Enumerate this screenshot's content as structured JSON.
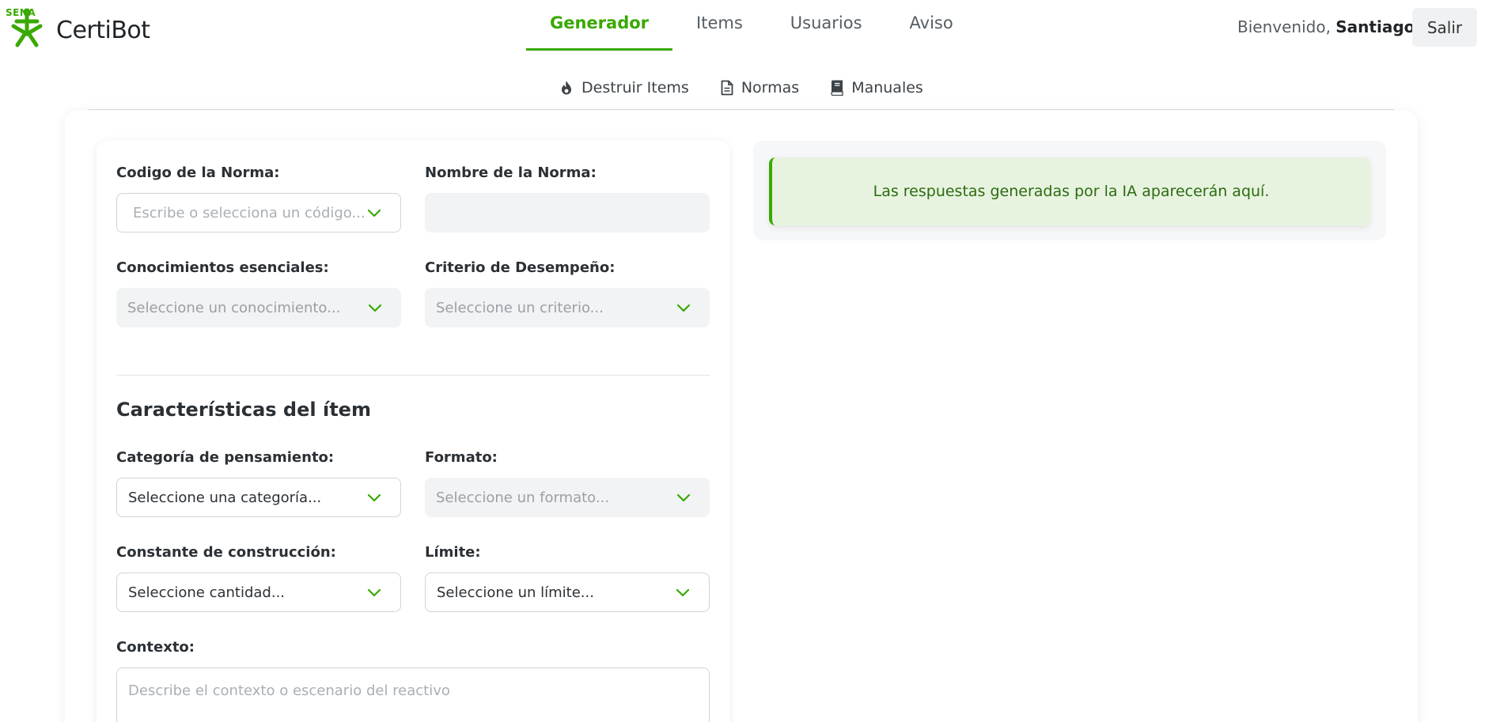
{
  "brand": {
    "mark": "SENA",
    "name": "CertiBot",
    "accent": "#39a900"
  },
  "nav": {
    "tabs": [
      {
        "label": "Generador",
        "active": true
      },
      {
        "label": "Items",
        "active": false
      },
      {
        "label": "Usuarios",
        "active": false
      },
      {
        "label": "Aviso",
        "active": false
      }
    ]
  },
  "user": {
    "greeting": "Bienvenido,",
    "name": "Santiago",
    "logout_label": "Salir"
  },
  "subnav": {
    "items": [
      {
        "label": "Destruir Items",
        "icon": "fire-icon"
      },
      {
        "label": "Normas",
        "icon": "document-icon"
      },
      {
        "label": "Manuales",
        "icon": "book-icon"
      }
    ]
  },
  "form": {
    "norma_code": {
      "label": "Codigo de la Norma:",
      "placeholder": "Escribe o selecciona un código..."
    },
    "norma_name": {
      "label": "Nombre de la Norma:",
      "value": ""
    },
    "conocimientos": {
      "label": "Conocimientos esenciales:",
      "placeholder": "Seleccione un conocimiento..."
    },
    "criterio": {
      "label": "Criterio de Desempeño:",
      "placeholder": "Seleccione un criterio..."
    },
    "section_title": "Características del ítem",
    "categoria": {
      "label": "Categoría de pensamiento:",
      "value": "Seleccione una categoría..."
    },
    "formato": {
      "label": "Formato:",
      "placeholder": "Seleccione un formato..."
    },
    "constante": {
      "label": "Constante de construcción:",
      "value": "Seleccione cantidad..."
    },
    "limite": {
      "label": "Límite:",
      "value": "Seleccione un límite..."
    },
    "contexto": {
      "label": "Contexto:",
      "placeholder": "Describe el contexto o escenario del reactivo"
    }
  },
  "response": {
    "placeholder": "Las respuestas generadas por la IA aparecerán aquí."
  }
}
